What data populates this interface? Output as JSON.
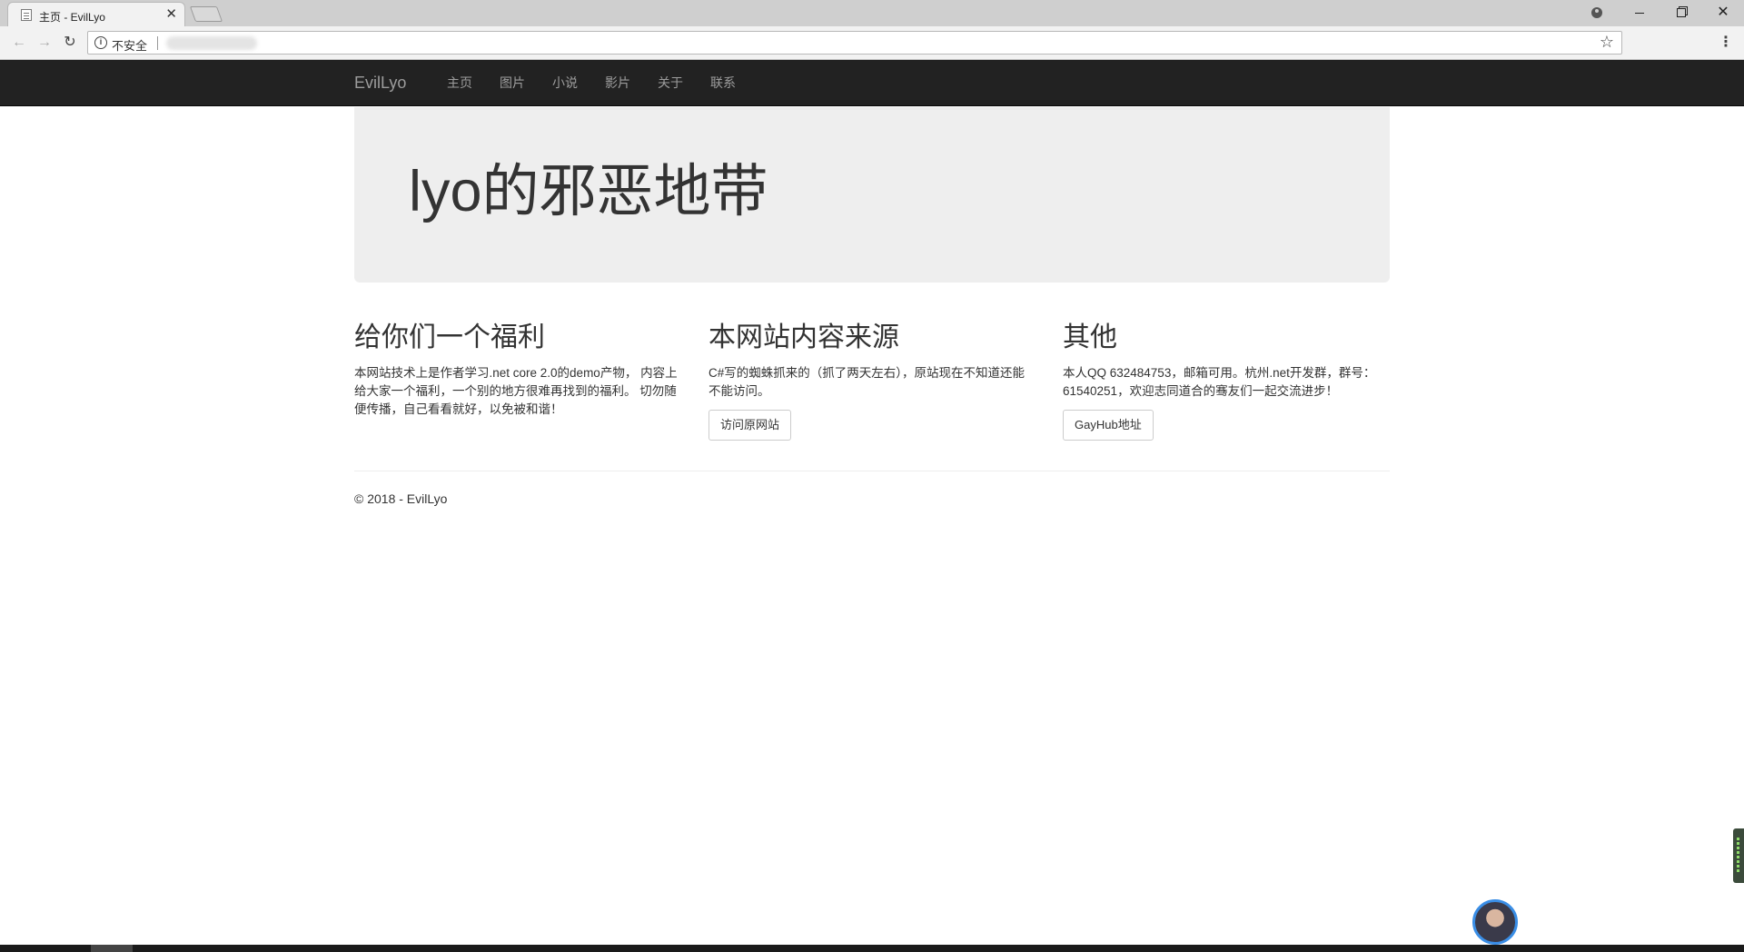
{
  "browser": {
    "tab_title": "主页 - EvilLyo",
    "tab_close": "✕",
    "security_label": "不安全"
  },
  "navbar": {
    "brand": "EvilLyo",
    "items": [
      "主页",
      "图片",
      "小说",
      "影片",
      "关于",
      "联系"
    ]
  },
  "jumbotron": {
    "title": "lyo的邪恶地带"
  },
  "columns": [
    {
      "heading": "给你们一个福利",
      "text": "本网站技术上是作者学习.net core 2.0的demo产物， 内容上给大家一个福利，一个别的地方很难再找到的福利。 切勿随便传播，自己看看就好，以免被和谐！"
    },
    {
      "heading": "本网站内容来源",
      "text": "C#写的蜘蛛抓来的（抓了两天左右），原站现在不知道还能不能访问。",
      "button": "访问原网站"
    },
    {
      "heading": "其他",
      "text": "本人QQ 632484753，邮箱可用。杭州.net开发群，群号：61540251，欢迎志同道合的骞友们一起交流进步！",
      "button": "GayHub地址"
    }
  ],
  "footer": {
    "text": "© 2018 - EvilLyo"
  },
  "colors": {
    "navbar_bg": "#222222",
    "navbar_text": "#9d9d9d",
    "jumbotron_bg": "#eeeeee",
    "text": "#333333"
  }
}
